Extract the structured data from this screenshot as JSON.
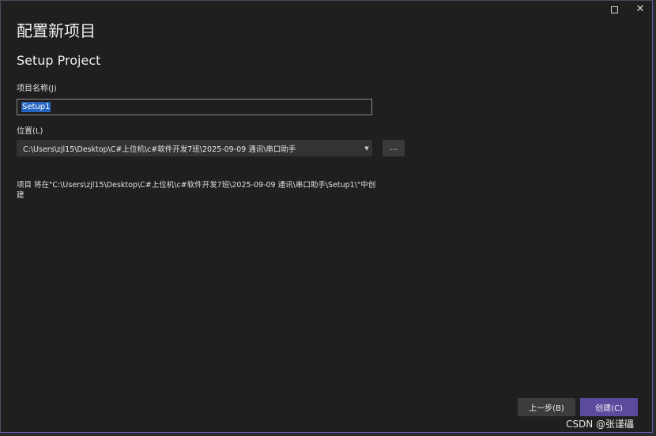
{
  "window": {
    "maximize_icon": "maximize-icon",
    "close_icon": "close-icon",
    "close_glyph": "✕"
  },
  "header": {
    "title": "配置新项目",
    "template_name": "Setup Project"
  },
  "form": {
    "project_name_label": "项目名称(J)",
    "project_name_value": "Setup1",
    "location_label": "位置(L)",
    "location_value": "C:\\Users\\zjl15\\Desktop\\C#上位机\\c#软件开发7班\\2025-09-09 通讯\\串口助手",
    "browse_label": "...",
    "info_text": "项目 将在\"C:\\Users\\zjl15\\Desktop\\C#上位机\\c#软件开发7班\\2025-09-09 通讯\\串口助手\\Setup1\\\"中创建"
  },
  "footer": {
    "back_label": "上一步(B)",
    "create_label": "创建(C)"
  },
  "watermark": "CSDN @张谨礧",
  "colors": {
    "background": "#1f1f1f",
    "accent": "#5c4a9e",
    "selection": "#2665c2"
  }
}
